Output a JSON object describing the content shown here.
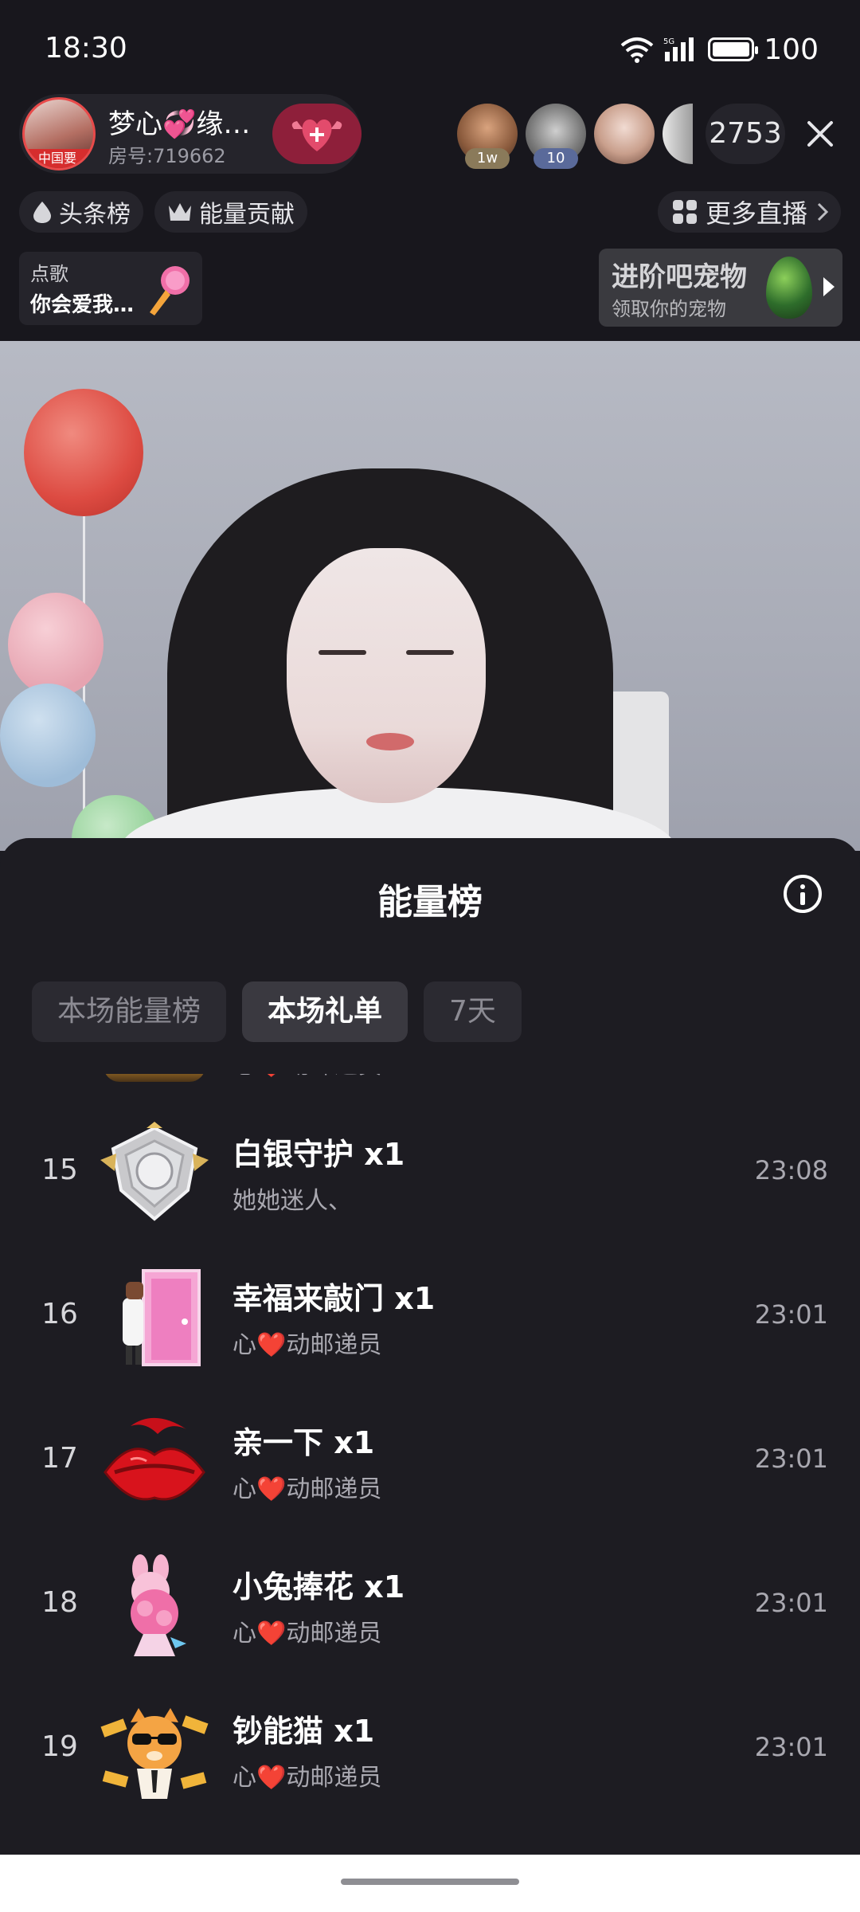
{
  "status_bar": {
    "time": "18:30",
    "signal_label": "5G",
    "battery": "100"
  },
  "host": {
    "name": "梦心💞缘…",
    "room": "房号:719662",
    "avatar_badge": "中国要",
    "follow_icon": "heart-wings-plus-icon"
  },
  "viewers": [
    {
      "badge": "1w",
      "badge_color": "#8a7a5a"
    },
    {
      "badge": "10",
      "badge_color": "#5a6a9a"
    },
    {
      "badge": ""
    },
    {
      "badge": ""
    }
  ],
  "viewer_count": "2753",
  "tags": [
    {
      "icon": "drop-icon",
      "label": "头条榜"
    },
    {
      "icon": "crown-icon",
      "label": "能量贡献"
    }
  ],
  "more_live": {
    "label": "更多直播"
  },
  "song": {
    "label": "点歌",
    "title": "你会爱我…"
  },
  "pet": {
    "title": "进阶吧宠物",
    "subtitle": "领取你的宠物"
  },
  "sheet": {
    "title": "能量榜",
    "tabs": [
      {
        "label": "本场能量榜",
        "active": false
      },
      {
        "label": "本场礼单",
        "active": true
      },
      {
        "label": "7天",
        "active": false
      }
    ],
    "partial_row": {
      "giver": "心❤️动邮递员"
    },
    "rows": [
      {
        "rank": "15",
        "gift": "白银守护  x1",
        "giver": "她她迷人、",
        "time": "23:08",
        "icon": "silver-guard-shield-icon"
      },
      {
        "rank": "16",
        "gift": "幸福来敲门  x1",
        "giver": "心❤️动邮递员",
        "time": "23:01",
        "icon": "pink-door-icon"
      },
      {
        "rank": "17",
        "gift": "亲一下  x1",
        "giver": "心❤️动邮递员",
        "time": "23:01",
        "icon": "red-lips-icon"
      },
      {
        "rank": "18",
        "gift": "小兔捧花  x1",
        "giver": "心❤️动邮递员",
        "time": "23:01",
        "icon": "bunny-bouquet-icon"
      },
      {
        "rank": "19",
        "gift": "钞能猫  x1",
        "giver": "心❤️动邮递员",
        "time": "23:01",
        "icon": "money-cat-icon"
      }
    ]
  },
  "colors": {
    "sheet_bg": "#1d1c22",
    "tab_bg": "#2b2a31",
    "active_tab_bg": "#3a3940",
    "follow_bg": "#8e1f3a"
  }
}
